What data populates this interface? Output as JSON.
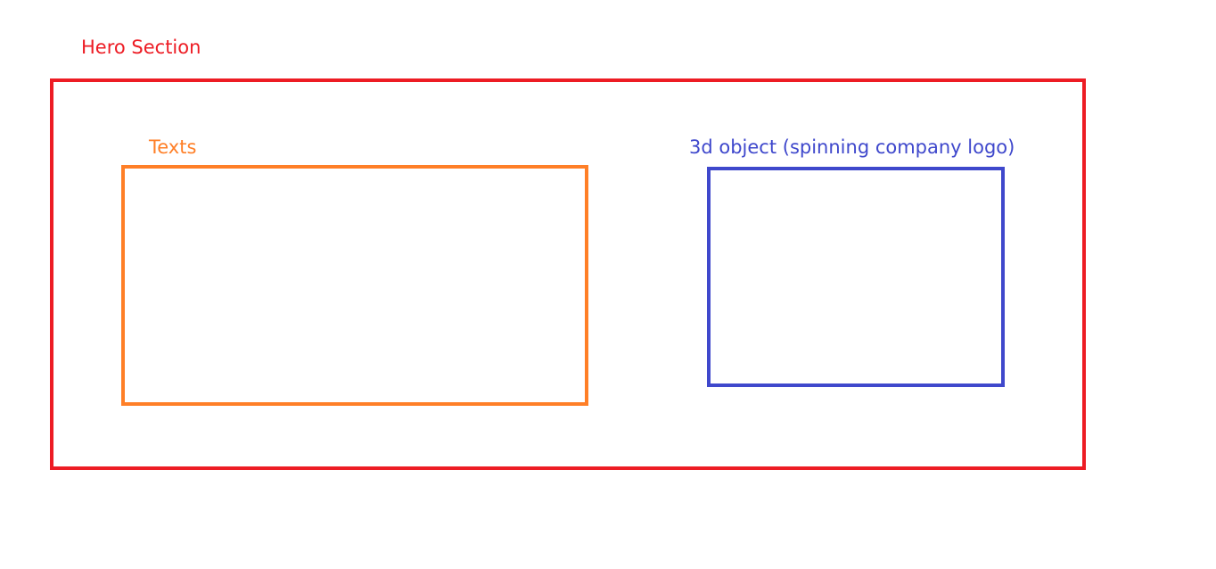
{
  "diagram": {
    "hero": {
      "label": "Hero Section",
      "color": "#ed1c24"
    },
    "texts": {
      "label": "Texts",
      "color": "#ff7f27"
    },
    "object3d": {
      "label": "3d object (spinning company logo)",
      "color": "#3f48cc"
    }
  }
}
